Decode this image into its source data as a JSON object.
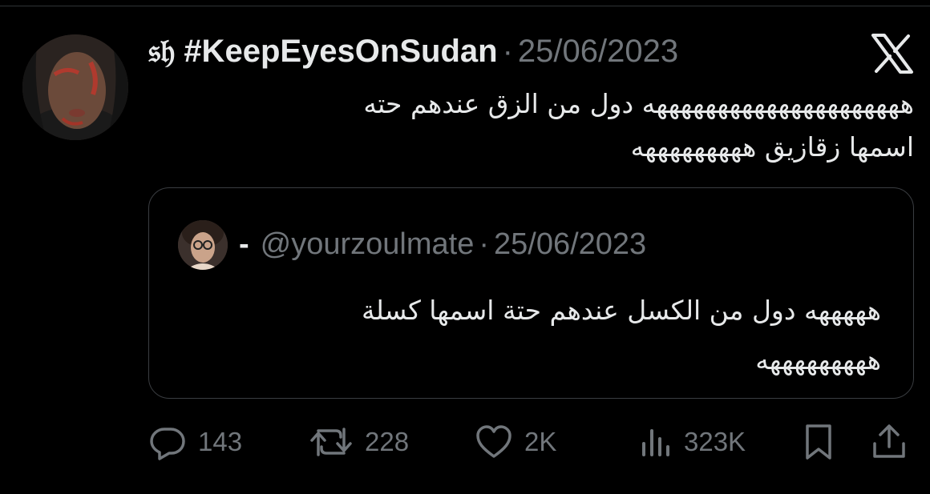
{
  "tweet": {
    "display_name": "𝔰𝔥 #KeepEyesOnSudan",
    "date": "25/06/2023",
    "text_line1": "هههههههههههههههههههههه دول من الزق عندهم حته",
    "text_line2": "اسمها زقازيق هههههههههه"
  },
  "quote": {
    "display_name": "-",
    "handle": "@yourzoulmate",
    "date": "25/06/2023",
    "text_line1": "هههههه دول من الكسل عندهم حتة اسمها كسلة",
    "text_line2": "هههههههههه"
  },
  "actions": {
    "replies": "143",
    "reposts": "228",
    "likes": "2K",
    "views": "323K"
  },
  "icons": {
    "brand": "x-logo",
    "reply": "reply-icon",
    "repost": "repost-icon",
    "like": "heart-icon",
    "views": "views-icon",
    "bookmark": "bookmark-icon",
    "share": "share-icon"
  },
  "colors": {
    "background": "#000000",
    "text": "#e7e9ea",
    "secondary": "#71767b",
    "border": "#3a3d41"
  }
}
